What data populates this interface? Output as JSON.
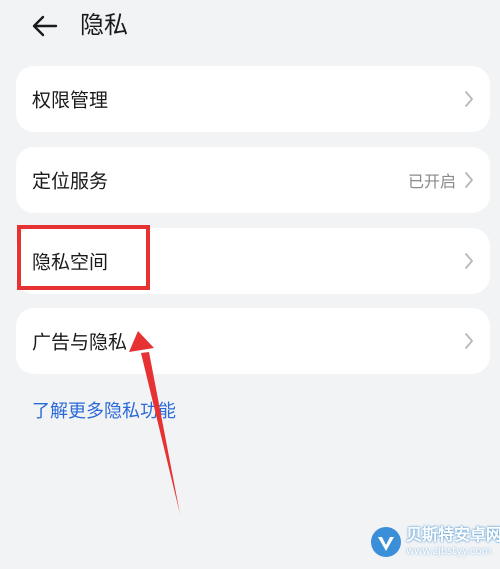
{
  "header": {
    "title": "隐私",
    "back_icon": "arrow-left-icon"
  },
  "items": [
    {
      "label": "权限管理",
      "value": ""
    },
    {
      "label": "定位服务",
      "value": "已开启"
    },
    {
      "label": "隐私空间",
      "value": ""
    },
    {
      "label": "广告与隐私",
      "value": ""
    }
  ],
  "more_link": {
    "label": "了解更多隐私功能"
  },
  "annotation": {
    "highlight_color": "#e63232",
    "arrow_color": "#e63232"
  },
  "colors": {
    "background": "#f1f3f5",
    "card": "#ffffff",
    "link": "#2a6ad8",
    "secondary_text": "#8a8a8a"
  },
  "watermark": {
    "name": "贝斯特安卓网",
    "url": "www.zjbstyy.com"
  }
}
